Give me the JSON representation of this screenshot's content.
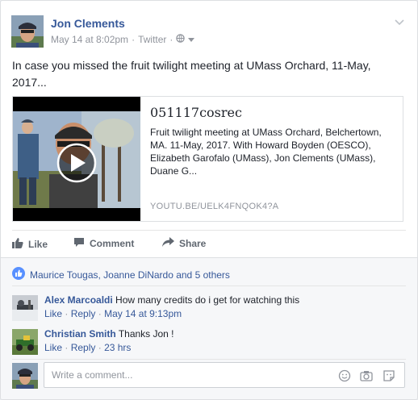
{
  "post": {
    "author": "Jon Clements",
    "date": "May 14 at 8:02pm",
    "via": "Twitter",
    "text": "In case you missed the fruit twilight meeting at UMass Orchard, 11-May, 2017..."
  },
  "preview": {
    "title": "051117cosrec",
    "description": "Fruit twilight meeting at UMass Orchard, Belchertown, MA. 11-May, 2017. With Howard Boyden (OESCO), Elizabeth Garofalo (UMass), Jon Clements (UMass), Duane G...",
    "link": "YOUTU.BE/UELK4FNQOK4?A"
  },
  "actions": {
    "like": "Like",
    "comment": "Comment",
    "share": "Share"
  },
  "likes_summary": "Maurice Tougas, Joanne DiNardo and 5 others",
  "comments": [
    {
      "author": "Alex Marcoaldi",
      "text": "How many credits do i get for watching this",
      "like": "Like",
      "reply": "Reply",
      "time": "May 14 at 9:13pm"
    },
    {
      "author": "Christian Smith",
      "text": "Thanks Jon !",
      "like": "Like",
      "reply": "Reply",
      "time": "23 hrs"
    }
  ],
  "composer": {
    "placeholder": "Write a comment..."
  },
  "colors": {
    "link": "#365899",
    "muted": "#90949c",
    "action": "#606770"
  }
}
